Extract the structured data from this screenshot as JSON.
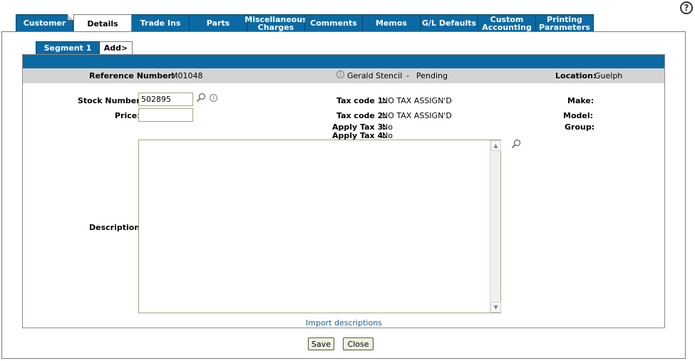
{
  "help_icon": "?",
  "tabs": [
    {
      "label": "Customer"
    },
    {
      "label": "Details"
    },
    {
      "label": "Trade Ins"
    },
    {
      "label": "Parts"
    },
    {
      "label": "Miscellaneous Charges"
    },
    {
      "label": "Comments"
    },
    {
      "label": "Memos"
    },
    {
      "label": "G/L Defaults"
    },
    {
      "label": "Custom Accounting"
    },
    {
      "label": "Printing Parameters"
    }
  ],
  "segment_tabs": [
    {
      "label": "Segment 1"
    },
    {
      "label": "Add>"
    }
  ],
  "header": {
    "reference_label": "Reference Number:",
    "reference_value": "M01048",
    "customer_name": "Gerald Stencil",
    "separator": "-",
    "status": "Pending",
    "location_label": "Location:",
    "location_value": "Guelph"
  },
  "form": {
    "stock_number_label": "Stock Number:",
    "stock_number_value": "502895",
    "price_label": "Price:",
    "price_value": "",
    "tax_code_1_label": "Tax code 1:",
    "tax_code_1_value": "NO TAX ASSIGN'D",
    "tax_code_2_label": "Tax code 2:",
    "tax_code_2_value": "NO TAX ASSIGN'D",
    "apply_tax_3_label": "Apply Tax 3:",
    "apply_tax_3_value": "No",
    "apply_tax_4_label": "Apply Tax 4:",
    "apply_tax_4_value": "No",
    "make_label": "Make:",
    "model_label": "Model:",
    "group_label": "Group:",
    "description_label": "Description:",
    "description_value": ""
  },
  "import_link": "Import descriptions",
  "buttons": {
    "save": "Save",
    "close": "Close"
  },
  "colors": {
    "tab_blue": "#0b6aa3",
    "header_grey": "#d4d4d4",
    "link_blue": "#1d5f95"
  },
  "icons": {
    "info": "info-icon",
    "lookup": "magnifier-icon",
    "help": "help-icon"
  }
}
